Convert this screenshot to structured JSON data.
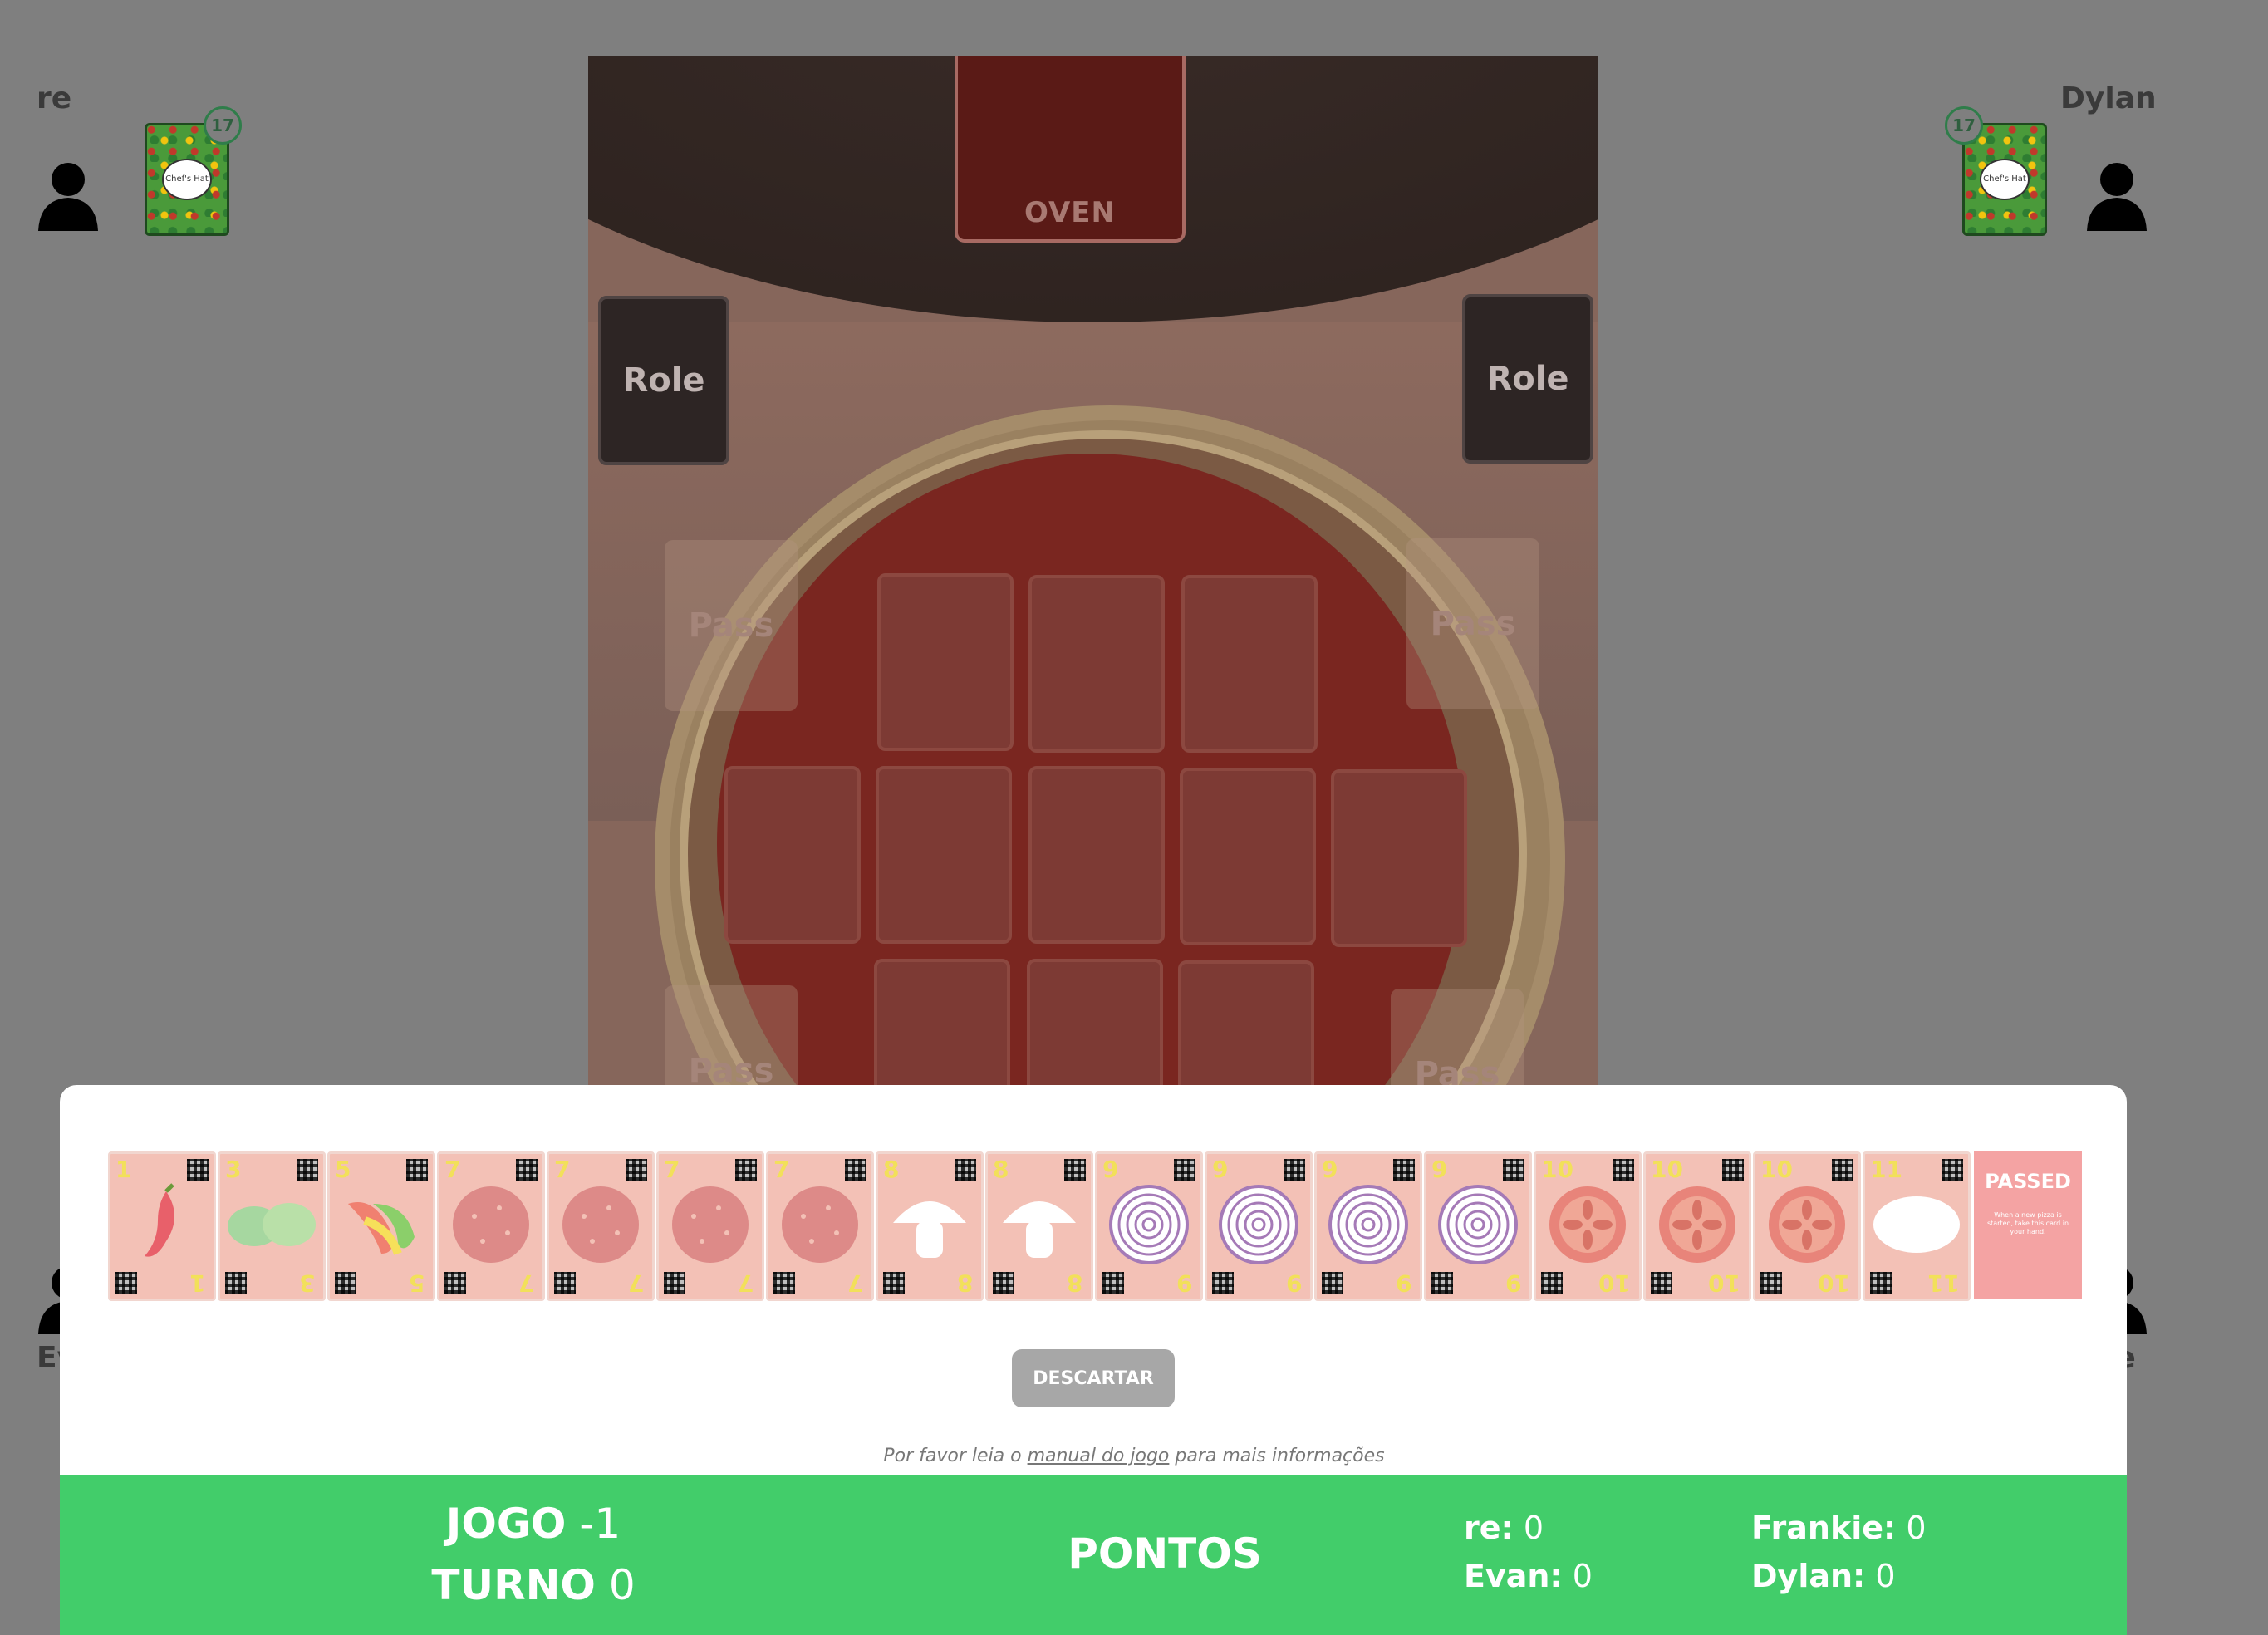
{
  "players": {
    "top_left": {
      "name": "re",
      "cards": "17"
    },
    "top_right": {
      "name": "Dylan",
      "cards": "17"
    },
    "bottom_left": {
      "name": "Ev"
    },
    "bottom_right": {
      "name": "ie"
    }
  },
  "deck_logo": "Chef's Hat",
  "board": {
    "oven_label": "OVEN",
    "role_label": "Role",
    "pass_label": "Pass"
  },
  "hand": [
    {
      "value": "1",
      "ingredient": "chili-pepper"
    },
    {
      "value": "3",
      "ingredient": "lettuce"
    },
    {
      "value": "5",
      "ingredient": "peppers"
    },
    {
      "value": "7",
      "ingredient": "salami"
    },
    {
      "value": "7",
      "ingredient": "salami"
    },
    {
      "value": "7",
      "ingredient": "salami"
    },
    {
      "value": "7",
      "ingredient": "salami"
    },
    {
      "value": "8",
      "ingredient": "mushroom"
    },
    {
      "value": "8",
      "ingredient": "mushroom"
    },
    {
      "value": "9",
      "ingredient": "onion"
    },
    {
      "value": "9",
      "ingredient": "onion"
    },
    {
      "value": "9",
      "ingredient": "onion"
    },
    {
      "value": "9",
      "ingredient": "onion"
    },
    {
      "value": "10",
      "ingredient": "tomato"
    },
    {
      "value": "10",
      "ingredient": "tomato"
    },
    {
      "value": "10",
      "ingredient": "tomato"
    },
    {
      "value": "11",
      "ingredient": "dough"
    }
  ],
  "passed_card": {
    "title": "PASSED",
    "text": "When a new pizza is started, take this card in your hand."
  },
  "actions": {
    "discard": "DESCARTAR"
  },
  "note": {
    "prefix": "Por favor leia o ",
    "link": "manual do jogo",
    "suffix": " para mais informações"
  },
  "score": {
    "game_label": "JOGO",
    "game_value": "-1",
    "turn_label": "TURNO",
    "turn_value": "0",
    "points_label": "PONTOS",
    "entries": [
      {
        "name": "re:",
        "points": "0"
      },
      {
        "name": "Evan:",
        "points": "0"
      },
      {
        "name": "Frankie:",
        "points": "0"
      },
      {
        "name": "Dylan:",
        "points": "0"
      }
    ]
  },
  "colors": {
    "score_bar": "#42cd6a",
    "card_bg": "#f3c1b6",
    "passed_card": "#f4a3a3"
  }
}
